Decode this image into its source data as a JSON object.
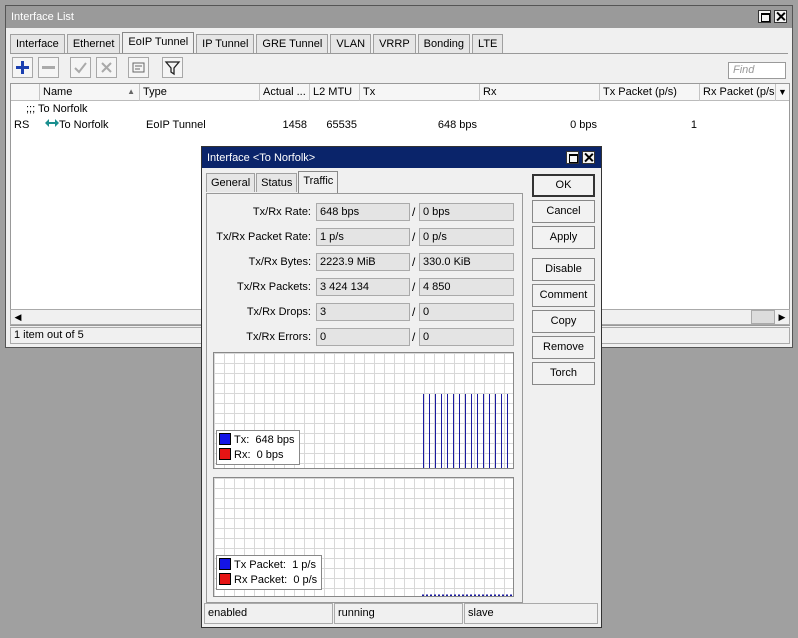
{
  "main": {
    "title": "Interface List",
    "tabs": [
      "Interface",
      "Ethernet",
      "EoIP Tunnel",
      "IP Tunnel",
      "GRE Tunnel",
      "VLAN",
      "VRRP",
      "Bonding",
      "LTE"
    ],
    "active_tab": "EoIP Tunnel",
    "find_placeholder": "Find",
    "columns": [
      "Name",
      "Type",
      "Actual ...",
      "L2 MTU",
      "Tx",
      "Rx",
      "Tx Packet (p/s)",
      "Rx Packet (p/s"
    ],
    "comment_row": ";;; To Norfolk",
    "row": {
      "flags": "RS",
      "name": "To Norfolk",
      "type": "EoIP Tunnel",
      "actual_mtu": "1458",
      "l2mtu": "65535",
      "tx": "648 bps",
      "rx": "0 bps",
      "tx_packet": "1",
      "rx_packet": ""
    },
    "status": "1 item out of 5"
  },
  "dialog": {
    "title": "Interface <To Norfolk>",
    "tabs": [
      "General",
      "Status",
      "Traffic"
    ],
    "active_tab": "Traffic",
    "fields": [
      {
        "label": "Tx/Rx Rate:",
        "tx": "648 bps",
        "rx": "0 bps"
      },
      {
        "label": "Tx/Rx Packet Rate:",
        "tx": "1 p/s",
        "rx": "0 p/s"
      },
      {
        "label": "Tx/Rx Bytes:",
        "tx": "2223.9 MiB",
        "rx": "330.0 KiB"
      },
      {
        "label": "Tx/Rx Packets:",
        "tx": "3 424 134",
        "rx": "4 850"
      },
      {
        "label": "Tx/Rx Drops:",
        "tx": "3",
        "rx": "0"
      },
      {
        "label": "Tx/Rx Errors:",
        "tx": "0",
        "rx": "0"
      }
    ],
    "separator": "/",
    "graph_traffic": {
      "tx_label": "Tx:",
      "tx_value": "648 bps",
      "rx_label": "Rx:",
      "rx_value": "0 bps"
    },
    "graph_packets": {
      "tx_label": "Tx Packet:",
      "tx_value": "1 p/s",
      "rx_label": "Rx Packet:",
      "rx_value": "0 p/s"
    },
    "buttons": [
      "OK",
      "Cancel",
      "Apply",
      "Disable",
      "Comment",
      "Copy",
      "Remove",
      "Torch"
    ],
    "status": [
      "enabled",
      "running",
      "slave"
    ]
  },
  "colors": {
    "tx": "#1414e6",
    "rx": "#e61414",
    "dialog_titlebar": "#0a246a",
    "inactive_titlebar": "#9a9a9a"
  }
}
